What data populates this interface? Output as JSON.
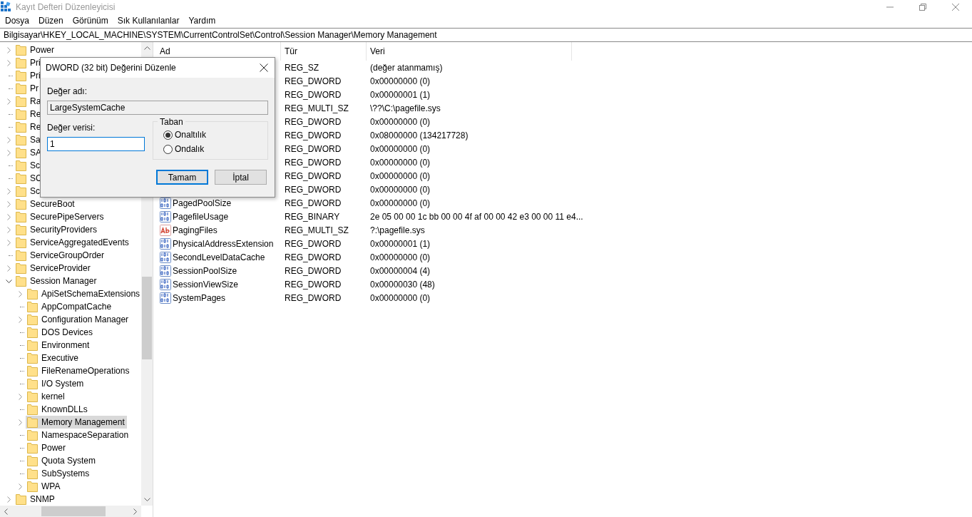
{
  "window": {
    "title": "Kayıt Defteri Düzenleyicisi"
  },
  "menu": [
    "Dosya",
    "Düzen",
    "Görünüm",
    "Sık Kullanılanlar",
    "Yardım"
  ],
  "address": "Bilgisayar\\HKEY_LOCAL_MACHINE\\SYSTEM\\CurrentControlSet\\Control\\Session Manager\\Memory Management",
  "tree": [
    {
      "label": "Power",
      "kind": "collapsed",
      "selected": false
    },
    {
      "label": "Pri",
      "kind": "collapsed",
      "selected": false
    },
    {
      "label": "Pri",
      "kind": "leaf",
      "selected": false
    },
    {
      "label": "Pr",
      "kind": "leaf",
      "selected": false
    },
    {
      "label": "Ra",
      "kind": "collapsed",
      "selected": false
    },
    {
      "label": "Re",
      "kind": "leaf",
      "selected": false
    },
    {
      "label": "Re",
      "kind": "leaf",
      "selected": false
    },
    {
      "label": "Sa",
      "kind": "collapsed",
      "selected": false
    },
    {
      "label": "SA",
      "kind": "collapsed",
      "selected": false
    },
    {
      "label": "Sc",
      "kind": "leaf",
      "selected": false
    },
    {
      "label": "SC",
      "kind": "leaf",
      "selected": false
    },
    {
      "label": "Sc",
      "kind": "collapsed",
      "selected": false
    },
    {
      "label": "SecureBoot",
      "kind": "collapsed",
      "selected": false
    },
    {
      "label": "SecurePipeServers",
      "kind": "collapsed",
      "selected": false
    },
    {
      "label": "SecurityProviders",
      "kind": "collapsed",
      "selected": false
    },
    {
      "label": "ServiceAggregatedEvents",
      "kind": "collapsed",
      "selected": false
    },
    {
      "label": "ServiceGroupOrder",
      "kind": "leaf",
      "selected": false
    },
    {
      "label": "ServiceProvider",
      "kind": "collapsed",
      "selected": false
    },
    {
      "label": "Session Manager",
      "kind": "expanded",
      "selected": false,
      "children": [
        {
          "label": "ApiSetSchemaExtensions",
          "kind": "collapsed",
          "selected": false
        },
        {
          "label": "AppCompatCache",
          "kind": "leaf",
          "selected": false
        },
        {
          "label": "Configuration Manager",
          "kind": "collapsed",
          "selected": false
        },
        {
          "label": "DOS Devices",
          "kind": "leaf",
          "selected": false
        },
        {
          "label": "Environment",
          "kind": "leaf",
          "selected": false
        },
        {
          "label": "Executive",
          "kind": "leaf",
          "selected": false
        },
        {
          "label": "FileRenameOperations",
          "kind": "leaf",
          "selected": false
        },
        {
          "label": "I/O System",
          "kind": "leaf",
          "selected": false
        },
        {
          "label": "kernel",
          "kind": "collapsed",
          "selected": false
        },
        {
          "label": "KnownDLLs",
          "kind": "leaf",
          "selected": false
        },
        {
          "label": "Memory Management",
          "kind": "collapsed",
          "selected": true
        },
        {
          "label": "NamespaceSeparation",
          "kind": "leaf",
          "selected": false
        },
        {
          "label": "Power",
          "kind": "leaf",
          "selected": false
        },
        {
          "label": "Quota System",
          "kind": "leaf",
          "selected": false
        },
        {
          "label": "SubSystems",
          "kind": "leaf",
          "selected": false
        },
        {
          "label": "WPA",
          "kind": "collapsed",
          "selected": false
        }
      ]
    },
    {
      "label": "SNMP",
      "kind": "collapsed",
      "selected": false
    }
  ],
  "list": {
    "columns": [
      "Ad",
      "Tür",
      "Veri"
    ],
    "rows": [
      {
        "type": "REG_SZ",
        "data": "(değer atanmamış)"
      },
      {
        "type": "REG_DWORD",
        "data": "0x00000000 (0)"
      },
      {
        "type": "REG_DWORD",
        "data": "0x00000001 (1)"
      },
      {
        "type": "REG_MULTI_SZ",
        "data": "\\??\\C:\\pagefile.sys"
      },
      {
        "type": "REG_DWORD",
        "data": "0x00000000 (0)"
      },
      {
        "type": "REG_DWORD",
        "data": "0x08000000 (134217728)"
      },
      {
        "type": "REG_DWORD",
        "data": "0x00000000 (0)"
      },
      {
        "type": "REG_DWORD",
        "data": "0x00000000 (0)"
      },
      {
        "type": "REG_DWORD",
        "data": "0x00000000 (0)"
      },
      {
        "type": "REG_DWORD",
        "data": "0x00000000 (0)"
      },
      {
        "kind": "binary",
        "name": "PagedPoolSize",
        "type": "REG_DWORD",
        "data": "0x00000000 (0)"
      },
      {
        "kind": "binary",
        "name": "PagefileUsage",
        "type": "REG_BINARY",
        "data": "2e 05 00 00 1c bb 00 00 4f af 00 00 42 e3 00 00 11 e4..."
      },
      {
        "kind": "string",
        "name": "PagingFiles",
        "type": "REG_MULTI_SZ",
        "data": "?:\\pagefile.sys"
      },
      {
        "kind": "binary",
        "name": "PhysicalAddressExtension",
        "type": "REG_DWORD",
        "data": "0x00000001 (1)"
      },
      {
        "kind": "binary",
        "name": "SecondLevelDataCache",
        "type": "REG_DWORD",
        "data": "0x00000000 (0)"
      },
      {
        "kind": "binary",
        "name": "SessionPoolSize",
        "type": "REG_DWORD",
        "data": "0x00000004 (4)"
      },
      {
        "kind": "binary",
        "name": "SessionViewSize",
        "type": "REG_DWORD",
        "data": "0x00000030 (48)"
      },
      {
        "kind": "binary",
        "name": "SystemPages",
        "type": "REG_DWORD",
        "data": "0x00000000 (0)"
      }
    ]
  },
  "dialog": {
    "title": "DWORD (32 bit) Değerini Düzenle",
    "name_label": "Değer adı:",
    "name_value": "LargeSystemCache",
    "data_label": "Değer verisi:",
    "data_value": "1",
    "base_group": "Taban",
    "base_options": [
      {
        "label": "Onaltılık",
        "selected": true
      },
      {
        "label": "Ondalık",
        "selected": false
      }
    ],
    "buttons": [
      {
        "label": "Tamam",
        "default": true
      },
      {
        "label": "İptal",
        "default": false
      }
    ]
  }
}
